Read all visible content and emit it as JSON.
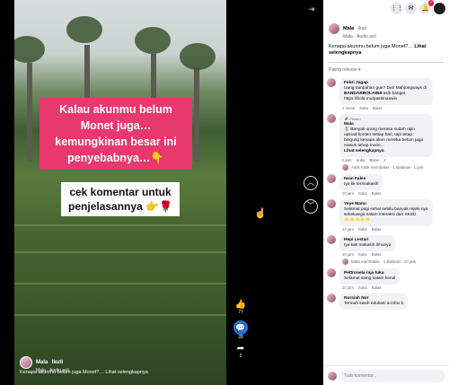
{
  "video": {
    "caption_pink": "Kalau akunmu belum Monet juga… kemungkinan besar ini penyebabnya…👇",
    "caption_white": "cek komentar untuk penjelasannya 👉🌹",
    "author": "Mala",
    "follow": "Ikuti",
    "audio": "Mala · Audio asli",
    "description": "Kenapa akunmu belum juga Monet?… Lihat selengkapnya"
  },
  "actions": {
    "likes": "77",
    "comments": "28",
    "shares": "2"
  },
  "panel": {
    "post": {
      "author": "Mala",
      "follow": "Ikuti",
      "audio": "Mala · Audio asli",
      "text": "Kenapa akunmu belum juga Monet?…",
      "see_more": "Lihat selengkapnya"
    },
    "sort_label": "Paling relevan ▾",
    "comments": [
      {
        "name": "Febri Jagap",
        "text": "Uang tambahan gue? Dari Mahjongways di",
        "bold": "BANDARBOLA855",
        "text2": "asik banget https://bola.mu/pastimaxwin",
        "time": "1 menit",
        "a1": "Suka",
        "a2": "Balas"
      },
      {
        "pinned": "📌 Pinned",
        "name": "Mala",
        "text": "🌷 Banyak orang merasa sudah rajin upload konten setiap hari, tapi tetap bingung kenapa akun mereka belum juga masuk tahap mone...",
        "more": "Lihat selengkapnya",
        "time": "2 jam",
        "a1": "Suka",
        "a2": "Balas",
        "likes": "2"
      },
      {
        "reply": "Astik Astik membalas · 1 Balasan",
        "reply_time": "1 jam"
      },
      {
        "name": "Iwan Fales",
        "text": "Iya kk terimakasih",
        "time": "10 jam",
        "a1": "Suka",
        "a2": "Balas"
      },
      {
        "name": "Yeye Manu",
        "text": "Selamat pagi sehat selalu banyak rejeki nya sekeluarga salam interaksi dan SKSD ⭐⭐⭐⭐⭐",
        "time": "12 jam",
        "a1": "Suka",
        "a2": "Balas"
      },
      {
        "name": "Hepi Lestari",
        "text": "Iya kak makasih ilmunya",
        "time": "10 jam",
        "a1": "Suka",
        "a2": "Balas"
      },
      {
        "reply": "Mala membalas · 1 Balasan",
        "reply_time": "10 jam"
      },
      {
        "name": "Pettronela raja tuka",
        "text": "Selamat siang salam kenal",
        "time": "10 jam",
        "a1": "Suka",
        "a2": "Balas"
      },
      {
        "name": "Nursiah Nur",
        "text": "Termah kasih edukasi & infox k",
        "time": "",
        "a1": "",
        "a2": ""
      }
    ],
    "composer_placeholder": "Tulis komentar..."
  }
}
